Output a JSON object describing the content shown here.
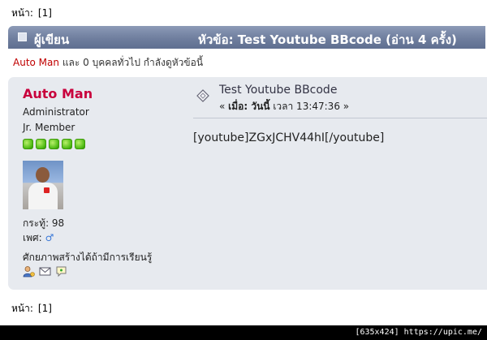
{
  "pagination": {
    "label": "หน้า:",
    "current": "[1]"
  },
  "category_bar": {
    "author_label": "ผู้เขียน",
    "topic_label": "หัวข้อ: Test Youtube BBcode  (อ่าน 4 ครั้ง)"
  },
  "viewers": {
    "user": "Auto Man",
    "rest": " และ 0 บุคคลทั่วไป กำลังดูหัวข้อนี้"
  },
  "poster": {
    "name": "Auto Man",
    "role": "Administrator",
    "rank": "Jr. Member",
    "stars": 5,
    "posts_label": "กระทู้: 98",
    "gender_label": "เพศ:",
    "gender_symbol": "♂",
    "signature": "ศักยภาพสร้างได้ถ้ามีการเรียนรู้"
  },
  "post": {
    "title": "Test Youtube BBcode",
    "date_prefix": "« ",
    "date_bold": "เมื่อ: วันนี้",
    "date_rest": " เวลา 13:47:36 »",
    "body": "[youtube]ZGxJCHV44hI[/youtube]"
  },
  "statusbar": {
    "text": "[635x424] https://upic.me/"
  },
  "colors": {
    "category_bar": "#6f7e9e",
    "post_background": "#e7eaef",
    "poster_name": "#c8003c",
    "viewer_link": "#c00000"
  }
}
